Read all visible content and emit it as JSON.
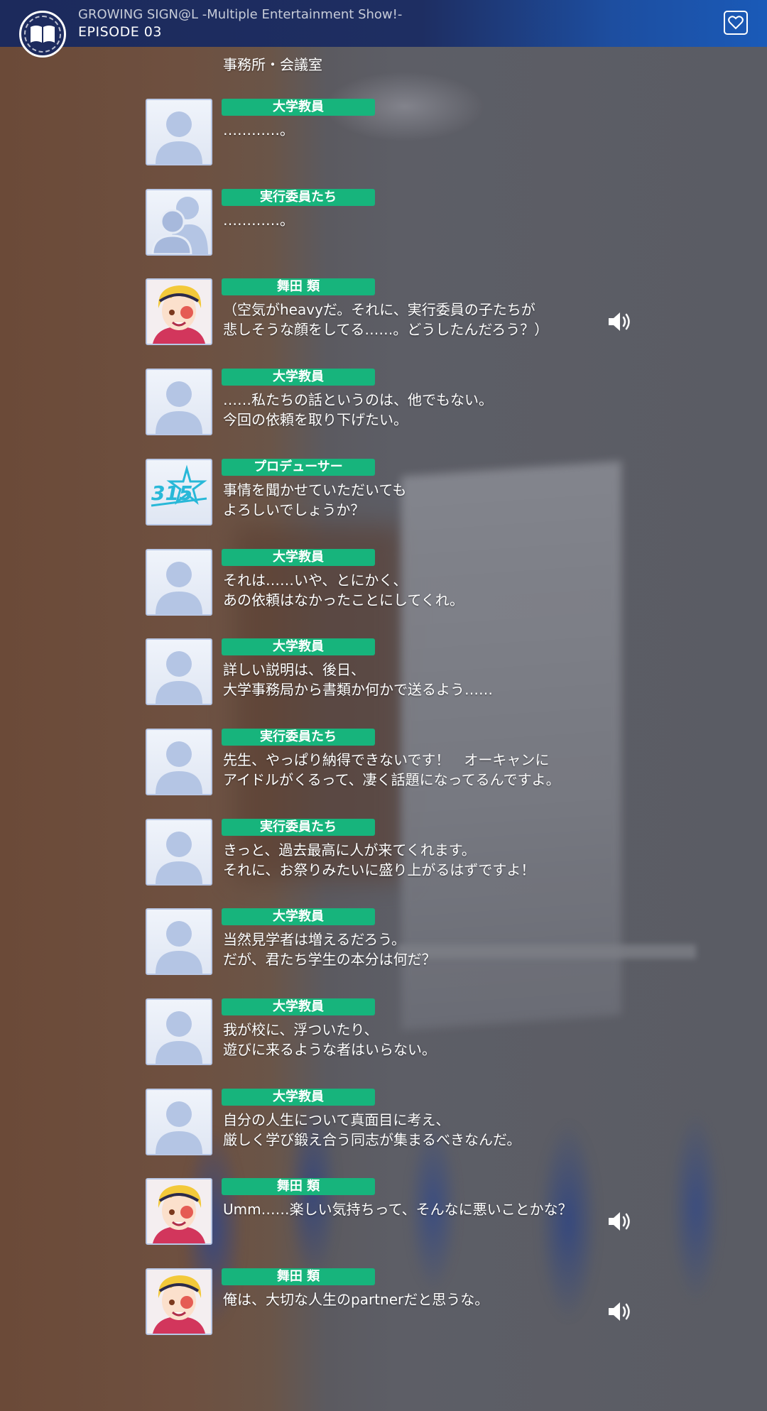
{
  "header": {
    "title": "GROWING SIGN@L -Multiple Entertainment Show!-",
    "episode": "EPISODE 03",
    "menu_icon": "book-icon",
    "favorite_icon": "heart-icon"
  },
  "location": "事務所・会議室",
  "colors": {
    "name_tag": "#17b47c",
    "header": "#1c2a5c",
    "avatar_border": "#b8c7e6"
  },
  "dialogue": [
    {
      "speaker": "大学教員",
      "avatar": "silhouette-single",
      "lines": [
        "…………。",
        ""
      ],
      "voice": false
    },
    {
      "speaker": "実行委員たち",
      "avatar": "silhouette-group",
      "lines": [
        "…………。",
        ""
      ],
      "voice": false
    },
    {
      "speaker": "舞田 類",
      "avatar": "character-rui",
      "lines": [
        "（空気がheavyだ。それに、実行委員の子たちが",
        "悲しそうな顔をしてる……。どうしたんだろう？）"
      ],
      "voice": true
    },
    {
      "speaker": "大学教員",
      "avatar": "silhouette-single",
      "lines": [
        "……私たちの話というのは、他でもない。",
        "今回の依頼を取り下げたい。"
      ],
      "voice": false
    },
    {
      "speaker": "プロデューサー",
      "avatar": "315-logo",
      "lines": [
        "事情を聞かせていただいても",
        "よろしいでしょうか？"
      ],
      "voice": false
    },
    {
      "speaker": "大学教員",
      "avatar": "silhouette-single",
      "lines": [
        "それは……いや、とにかく、",
        "あの依頼はなかったことにしてくれ。"
      ],
      "voice": false
    },
    {
      "speaker": "大学教員",
      "avatar": "silhouette-single",
      "lines": [
        "詳しい説明は、後日、",
        "大学事務局から書類か何かで送るよう……"
      ],
      "voice": false
    },
    {
      "speaker": "実行委員たち",
      "avatar": "silhouette-single",
      "lines": [
        "先生、やっぱり納得できないです！　オーキャンに",
        "アイドルがくるって、凄く話題になってるんですよ。"
      ],
      "voice": false
    },
    {
      "speaker": "実行委員たち",
      "avatar": "silhouette-single",
      "lines": [
        "きっと、過去最高に人が来てくれます。",
        "それに、お祭りみたいに盛り上がるはずですよ！"
      ],
      "voice": false
    },
    {
      "speaker": "大学教員",
      "avatar": "silhouette-single",
      "lines": [
        "当然見学者は増えるだろう。",
        "だが、君たち学生の本分は何だ？"
      ],
      "voice": false
    },
    {
      "speaker": "大学教員",
      "avatar": "silhouette-single",
      "lines": [
        "我が校に、浮ついたり、",
        "遊びに来るような者はいらない。"
      ],
      "voice": false
    },
    {
      "speaker": "大学教員",
      "avatar": "silhouette-single",
      "lines": [
        "自分の人生について真面目に考え、",
        "厳しく学び鍛え合う同志が集まるべきなんだ。"
      ],
      "voice": false
    },
    {
      "speaker": "舞田 類",
      "avatar": "character-rui",
      "lines": [
        "Umm……楽しい気持ちって、そんなに悪いことかな？",
        ""
      ],
      "voice": true
    },
    {
      "speaker": "舞田 類",
      "avatar": "character-rui",
      "lines": [
        "俺は、大切な人生のpartnerだと思うな。",
        ""
      ],
      "voice": true
    }
  ]
}
